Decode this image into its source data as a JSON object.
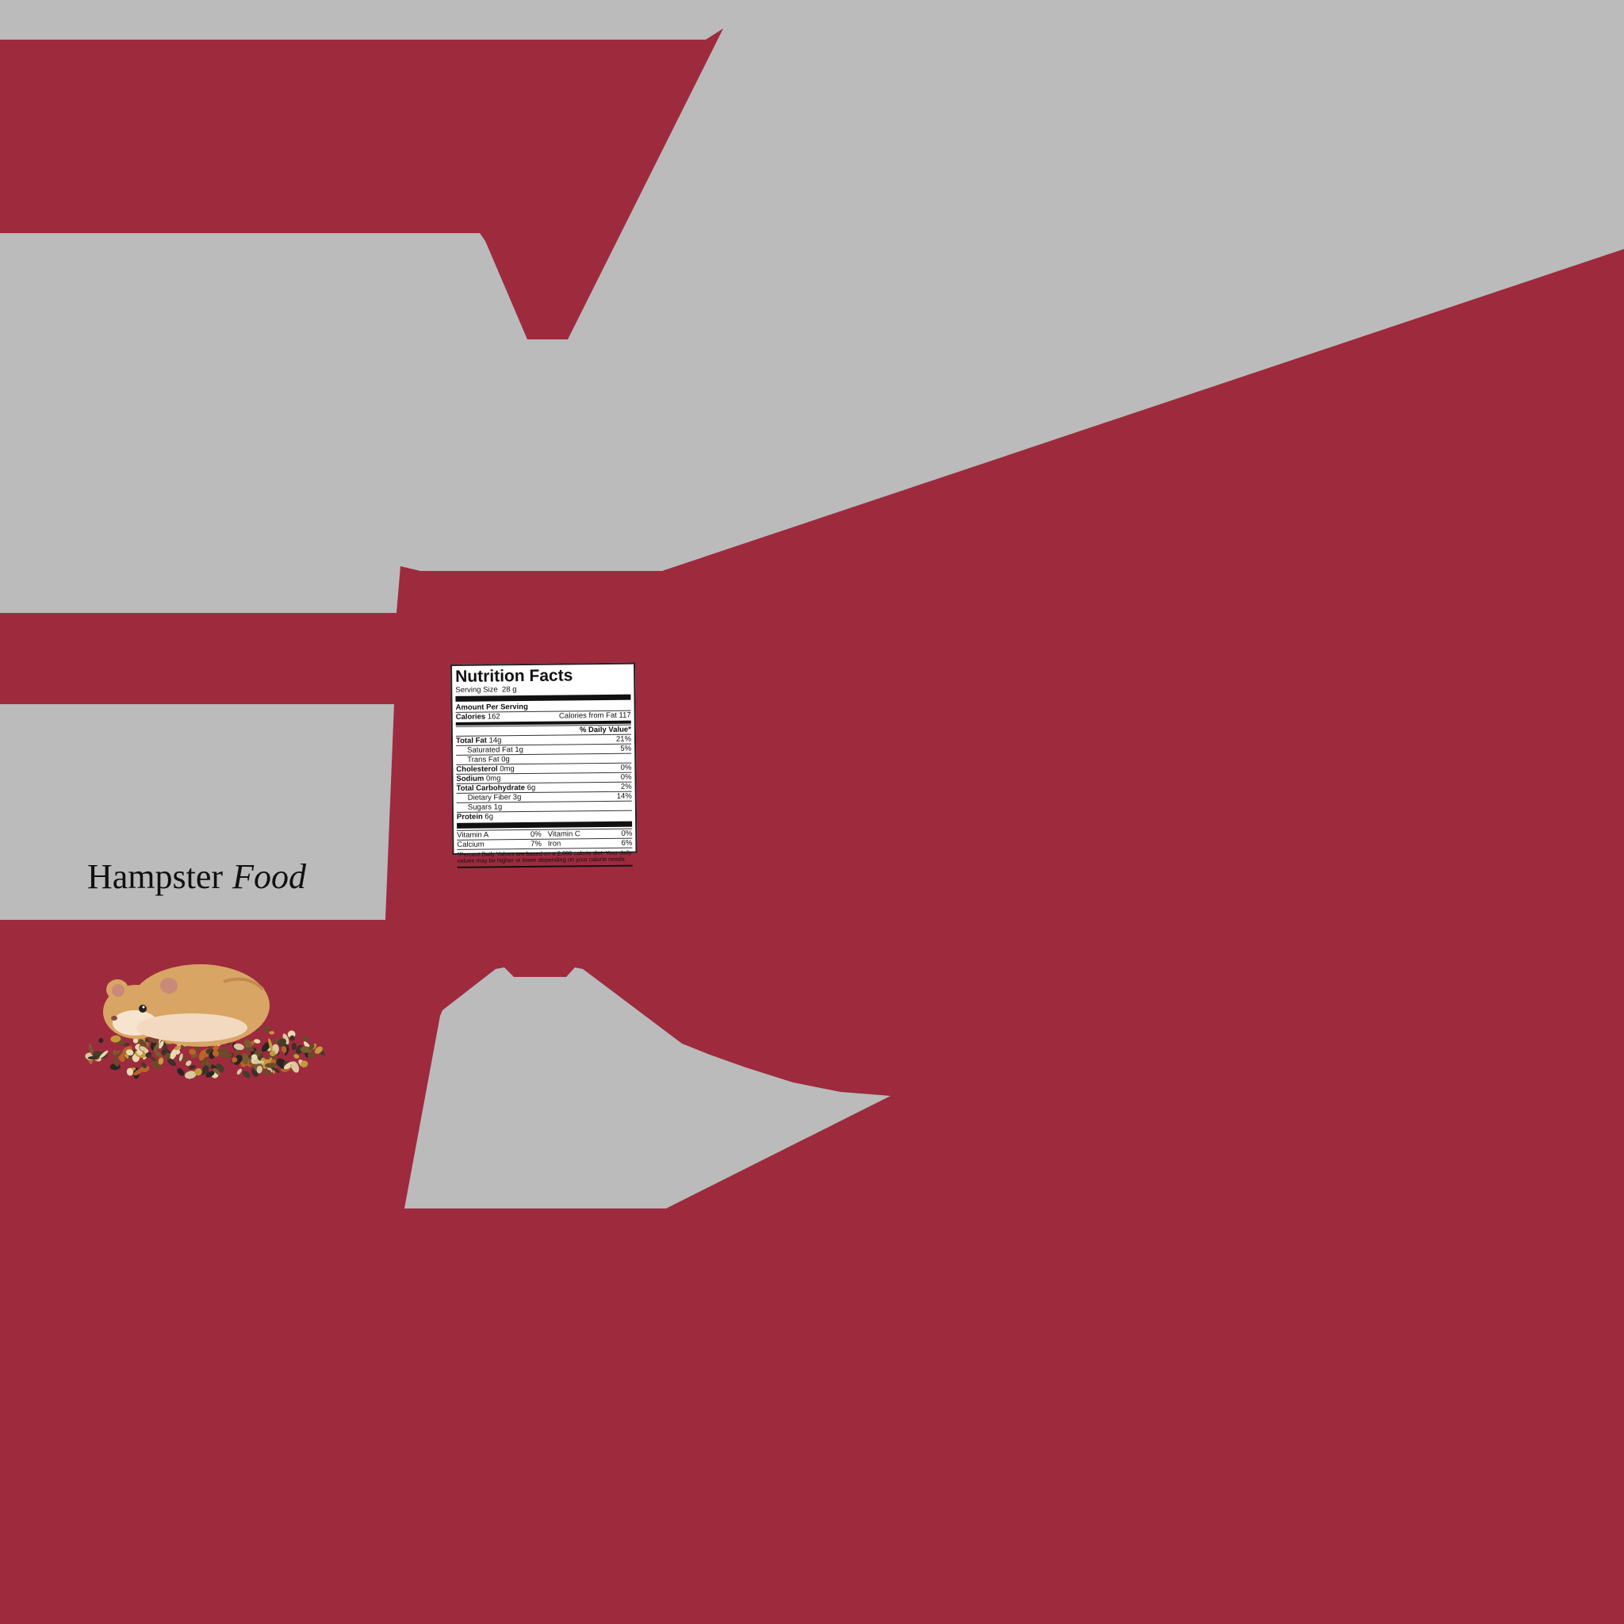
{
  "brand": {
    "name_part1": "Hampster",
    "name_part2": "Food"
  },
  "colors": {
    "background": "#9e2a3e",
    "panel": "#bbbbbb",
    "hamster_fur": "#d9a564",
    "ear": "#c98a7a"
  },
  "illustration": {
    "subject": "hamster-on-seed-pile"
  },
  "nutrition": {
    "title": "Nutrition Facts",
    "serving_label": "Serving Size",
    "serving_value": "28 g",
    "amount_per_serving": "Amount Per Serving",
    "calories_label": "Calories",
    "calories_value": "162",
    "calories_fat_label": "Calories from Fat",
    "calories_fat_value": "117",
    "daily_value_header": "% Daily Value*",
    "rows": [
      {
        "label": "Total Fat",
        "amount": "14g",
        "dv": "21%",
        "bold": true,
        "indent": false
      },
      {
        "label": "Saturated Fat",
        "amount": "1g",
        "dv": "5%",
        "bold": false,
        "indent": true
      },
      {
        "label": "Trans Fat",
        "amount": "0g",
        "dv": "",
        "bold": false,
        "indent": true
      },
      {
        "label": "Cholesterol",
        "amount": "0mg",
        "dv": "0%",
        "bold": true,
        "indent": false
      },
      {
        "label": "Sodium",
        "amount": "0mg",
        "dv": "0%",
        "bold": true,
        "indent": false
      },
      {
        "label": "Total Carbohydrate",
        "amount": "6g",
        "dv": "2%",
        "bold": true,
        "indent": false
      },
      {
        "label": "Dietary Fiber",
        "amount": "3g",
        "dv": "14%",
        "bold": false,
        "indent": true
      },
      {
        "label": "Sugars",
        "amount": "1g",
        "dv": "",
        "bold": false,
        "indent": true
      },
      {
        "label": "Protein",
        "amount": "6g",
        "dv": "",
        "bold": true,
        "indent": false
      }
    ],
    "vitamins": [
      {
        "label": "Vitamin A",
        "dv": "0%",
        "label2": "Vitamin C",
        "dv2": "0%"
      },
      {
        "label": "Calcium",
        "dv": "7%",
        "label2": "Iron",
        "dv2": "6%"
      }
    ],
    "footnote": "*Percent Daily Values are based on a 2,000 calorie diet. Your daily values may be higher or lower depending on your calorie needs."
  }
}
